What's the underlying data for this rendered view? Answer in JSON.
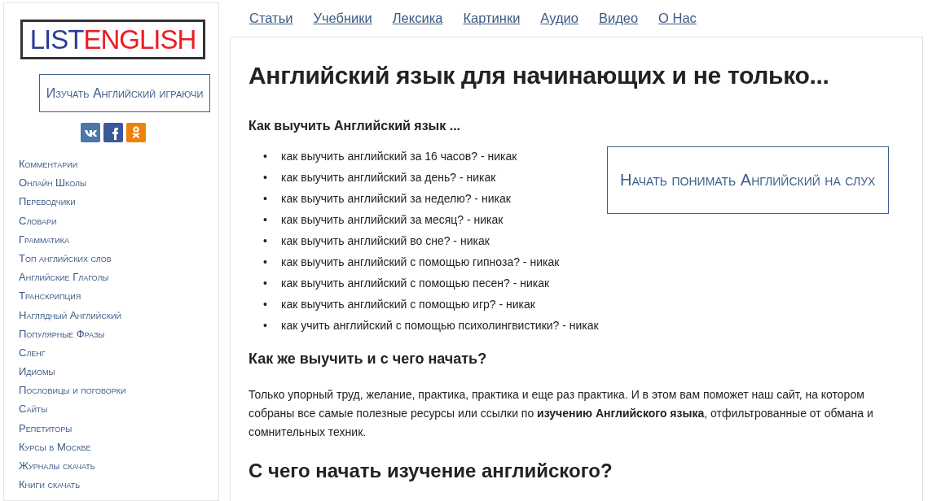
{
  "sidebar": {
    "logo": [
      {
        "text": "LIST",
        "color": "#2b3b94"
      },
      {
        "text": "ENGLISH",
        "color": "#ec1c24"
      }
    ],
    "promo_button": "Изучать Английский играючи",
    "social": [
      {
        "kind": "vk",
        "color": "#4a76a8"
      },
      {
        "kind": "facebook",
        "color": "#3b5998"
      },
      {
        "kind": "ok",
        "color": "#ee8208"
      }
    ],
    "items": [
      "Комментарии",
      "Онлайн Школы",
      "Переводчики",
      "Словари",
      "Грамматика",
      "Топ английских слов",
      "Английские Глаголы",
      "Транскрипция",
      "Наглядный Английский",
      "Популярные Фразы",
      "Сленг",
      "Идиомы",
      "Пословицы и поговорки",
      "Сайты",
      "Репетиторы",
      "Курсы в Москве",
      "Журналы скачать",
      "Книги скачать"
    ]
  },
  "nav": [
    "Статьи",
    "Учебники",
    "Лексика",
    "Картинки",
    "Аудио",
    "Видео",
    "О Нас"
  ],
  "article": {
    "title": "Английский язык для начинающих и не только...",
    "subtitle": "Как выучить Английский язык ...",
    "list_marker": "•",
    "list": [
      "как выучить английский за 16 часов? - никак",
      "как выучить английский за день? - никак",
      "как выучить английский за неделю? - никак",
      "как выучить английский за месяц? - никак",
      "как выучить английский во сне? - никак",
      "как выучить английский с помощью гипноза? - никак",
      "как выучить английский с помощью песен? - никак",
      "как выучить английский с помощью игр? - никак",
      "как учить английский с помощью психолингвистики? - никак"
    ],
    "cta_button": "Начать понимать Английский на слух",
    "heading_2": "Как же выучить и с чего начать?",
    "paragraph": "Только упорный труд, желание, практика, практика и еще раз практика. И в этом вам поможет наш сайт, на котором собраны все самые полезные ресурсы или ссылки по **изучению Английского языка**, отфильтрованные от обмана и сомнительных техник.",
    "heading_3": "С чего начать изучение английского?"
  }
}
